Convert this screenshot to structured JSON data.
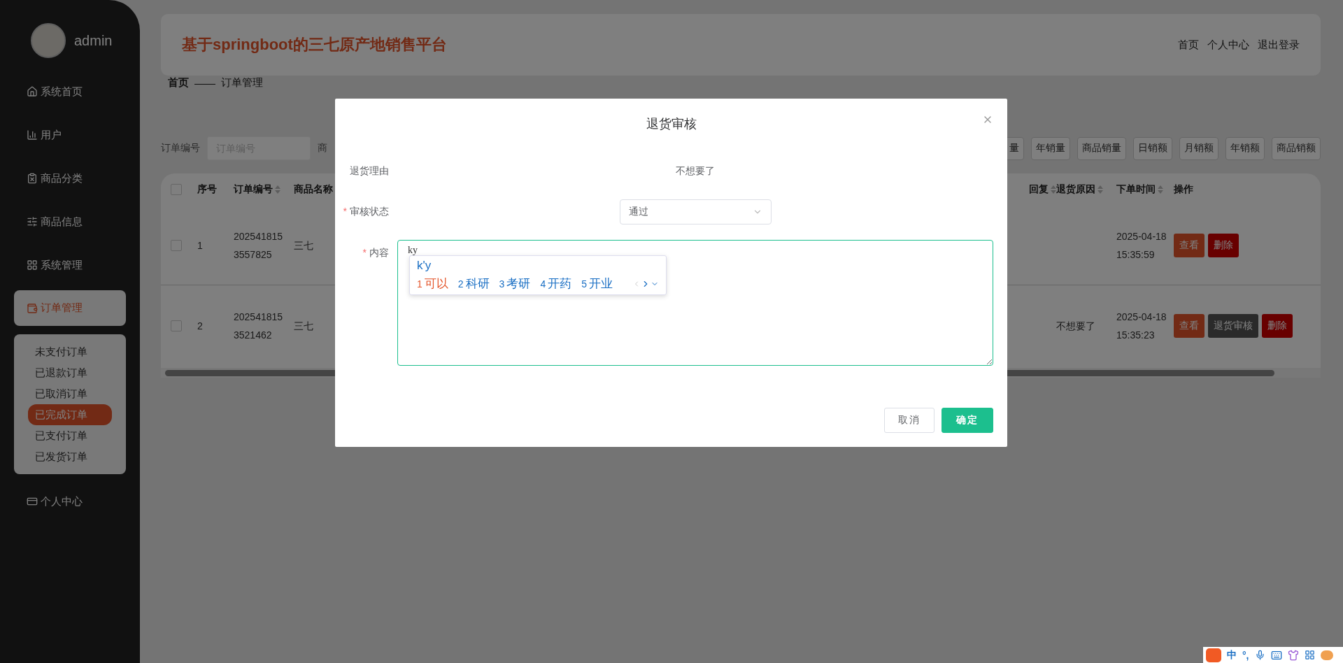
{
  "sidebar": {
    "user": {
      "name": "admin"
    },
    "items": [
      {
        "label": "系统首页",
        "kind": "home",
        "selected": false
      },
      {
        "label": "用户",
        "kind": "chart",
        "selected": false
      },
      {
        "label": "商品分类",
        "kind": "clipboard",
        "selected": false
      },
      {
        "label": "商品信息",
        "kind": "sliders",
        "selected": false
      },
      {
        "label": "系统管理",
        "kind": "grid",
        "selected": false
      },
      {
        "label": "订单管理",
        "kind": "wallet",
        "selected": true,
        "children": [
          {
            "label": "未支付订单",
            "selected": false
          },
          {
            "label": "已退款订单",
            "selected": false
          },
          {
            "label": "已取消订单",
            "selected": false
          },
          {
            "label": "已完成订单",
            "selected": true
          },
          {
            "label": "已支付订单",
            "selected": false
          },
          {
            "label": "已发货订单",
            "selected": false
          }
        ]
      },
      {
        "label": "个人中心",
        "kind": "card",
        "selected": false
      }
    ]
  },
  "header": {
    "title": "基于springboot的三七原产地销售平台",
    "links": [
      "首页",
      "个人中心",
      "退出登录"
    ]
  },
  "breadcrumb": {
    "home": "首页",
    "separator": "——",
    "current": "订单管理"
  },
  "toolbar": {
    "search_label": "订单编号",
    "search_placeholder": "订单编号",
    "next_label": "商",
    "buttons": [
      "量",
      "年销量",
      "商品销量",
      "日销额",
      "月销额",
      "年销额",
      "商品销额"
    ]
  },
  "table": {
    "select_all_checked": false,
    "columns_left": [
      {
        "label": "序号",
        "sortable": false
      },
      {
        "label": "订单编号",
        "sortable": true
      },
      {
        "label": "商品名称"
      }
    ],
    "columns_right": [
      {
        "label": "回复",
        "sortable": true
      },
      {
        "label": "退货原因",
        "sortable": true
      },
      {
        "label": "下单时间",
        "sortable": true
      },
      {
        "label": "操作",
        "sortable": false
      }
    ],
    "rows": [
      {
        "checked": false,
        "index": "1",
        "order_no": "2025418153557825",
        "name": "三七",
        "time": "2025-04-18 15:35:59",
        "actions": [
          {
            "label": "查看",
            "kind": "view"
          },
          {
            "label": "删除",
            "kind": "delete"
          }
        ]
      },
      {
        "checked": false,
        "index": "2",
        "order_no": "2025418153521462",
        "name": "三七",
        "reason": "不想要了",
        "time": "2025-04-18 15:35:23",
        "actions": [
          {
            "label": "查看",
            "kind": "view"
          },
          {
            "label": "退货审核",
            "kind": "review"
          },
          {
            "label": "删除",
            "kind": "delete"
          }
        ]
      }
    ]
  },
  "dialog": {
    "title": "退货审核",
    "fields": [
      {
        "kind": "text",
        "label": "退货理由",
        "value": "不想要了"
      },
      {
        "kind": "select",
        "label": "审核状态",
        "marker": "*",
        "value": "通过"
      },
      {
        "kind": "textarea",
        "label": "内容",
        "marker": "*",
        "value": "ky"
      }
    ],
    "buttons": [
      {
        "label": "取消",
        "kind": "default"
      },
      {
        "label": "确定",
        "kind": "primary"
      }
    ]
  },
  "ime_popup": {
    "composition": "k'y",
    "candidates": [
      {
        "number": "1",
        "text": "可以",
        "selected": true
      },
      {
        "number": "2",
        "text": "科研",
        "selected": false
      },
      {
        "number": "3",
        "text": "考研",
        "selected": false
      },
      {
        "number": "4",
        "text": "开药",
        "selected": false
      },
      {
        "number": "5",
        "text": "开业",
        "selected": false
      }
    ]
  },
  "ime_bar": {
    "mode": "中",
    "punctuation": "°,"
  }
}
